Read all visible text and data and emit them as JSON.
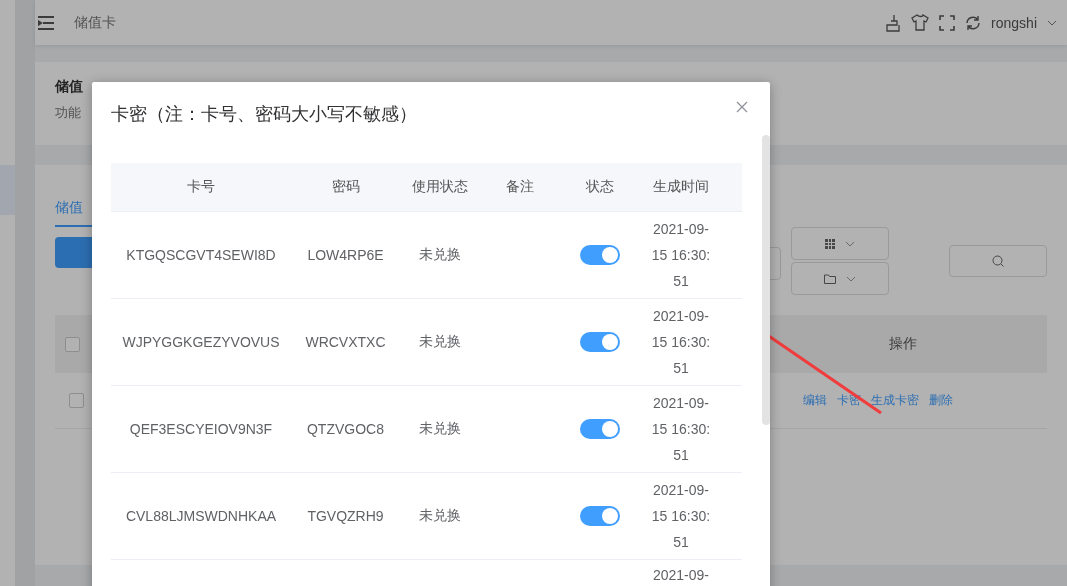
{
  "header": {
    "breadcrumb": "储值卡",
    "user": "rongshi"
  },
  "page": {
    "card_title": "储值",
    "card_desc": "功能",
    "tab": "储值",
    "select_all_checked": false,
    "row_checked": false,
    "table_header_action": "操作",
    "row_actions": [
      "编辑",
      "卡密",
      "生成卡密",
      "删除"
    ]
  },
  "dialog": {
    "title": "卡密（注：卡号、密码大小写不敏感）",
    "columns": [
      "卡号",
      "密码",
      "使用状态",
      "备注",
      "状态",
      "生成时间"
    ],
    "rows": [
      {
        "card": "KTGQSCGVT4SEWI8D",
        "password": "LOW4RP6E",
        "usage": "未兑换",
        "enabled": true,
        "time": "2021-09-15 16:30:51"
      },
      {
        "card": "WJPYGGKGEZYVOVUS",
        "password": "WRCVXTXC",
        "usage": "未兑换",
        "enabled": true,
        "time": "2021-09-15 16:30:51"
      },
      {
        "card": "QEF3ESCYEIOV9N3F",
        "password": "QTZVGOC8",
        "usage": "未兑换",
        "enabled": true,
        "time": "2021-09-15 16:30:51"
      },
      {
        "card": "CVL88LJMSWDNHKAA",
        "password": "TGVQZRH9",
        "usage": "未兑换",
        "enabled": true,
        "time": "2021-09-15 16:30:51"
      },
      {
        "time": "2021-09-"
      }
    ]
  }
}
